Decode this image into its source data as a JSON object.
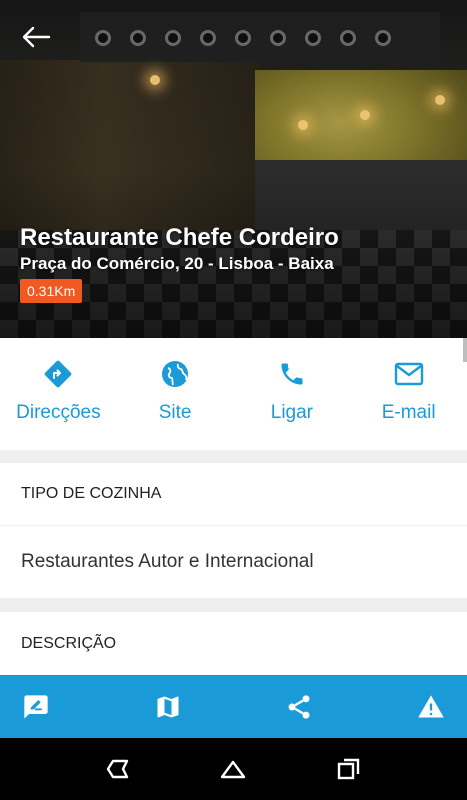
{
  "header": {
    "restaurant_name": "Restaurante Chefe Cordeiro",
    "address": "Praça do Comércio, 20 - Lisboa - Baixa",
    "distance": "0.31Km",
    "back_icon": "arrow-left-icon"
  },
  "actions": [
    {
      "label": "Direcções",
      "icon": "directions-icon"
    },
    {
      "label": "Site",
      "icon": "globe-icon"
    },
    {
      "label": "Ligar",
      "icon": "phone-icon"
    },
    {
      "label": "E-mail",
      "icon": "mail-icon"
    }
  ],
  "cuisine": {
    "heading": "TIPO DE COZINHA",
    "value": "Restaurantes Autor e Internacional"
  },
  "description": {
    "heading": "DESCRIÇÃO"
  },
  "toolbar": {
    "icons": [
      "review-icon",
      "map-icon",
      "share-icon",
      "warning-icon"
    ]
  },
  "navbar": {
    "icons": [
      "back-nav-icon",
      "home-nav-icon",
      "recents-nav-icon"
    ]
  },
  "colors": {
    "accent": "#1a9ad6",
    "badge": "#f05a22"
  }
}
